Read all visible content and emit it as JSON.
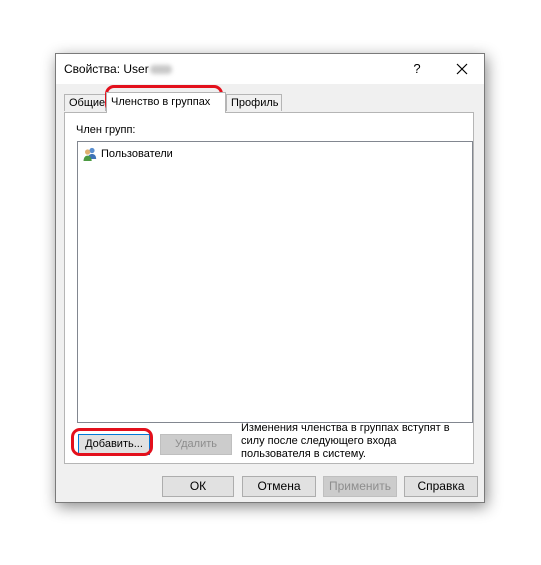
{
  "dialog": {
    "title": "Свойства: User",
    "help_glyph": "?",
    "close_glyph": "close-icon"
  },
  "tabs": [
    {
      "label": "Общие",
      "selected": false
    },
    {
      "label": "Членство в группах",
      "selected": true
    },
    {
      "label": "Профиль",
      "selected": false
    }
  ],
  "panel": {
    "group_label": "Член групп:",
    "groups": [
      {
        "name": "Пользователи",
        "icon": "users-group-icon"
      }
    ],
    "add_button": "Добавить...",
    "remove_button": "Удалить",
    "info_text": "Изменения членства в группах вступят в силу после следующего входа пользователя в систему."
  },
  "footer": {
    "ok": "ОК",
    "cancel": "Отмена",
    "apply": "Применить",
    "help": "Справка"
  },
  "colors": {
    "highlight": "#e3101c",
    "dialog_bg": "#f0f0f0",
    "focus_border": "#0078d7"
  }
}
